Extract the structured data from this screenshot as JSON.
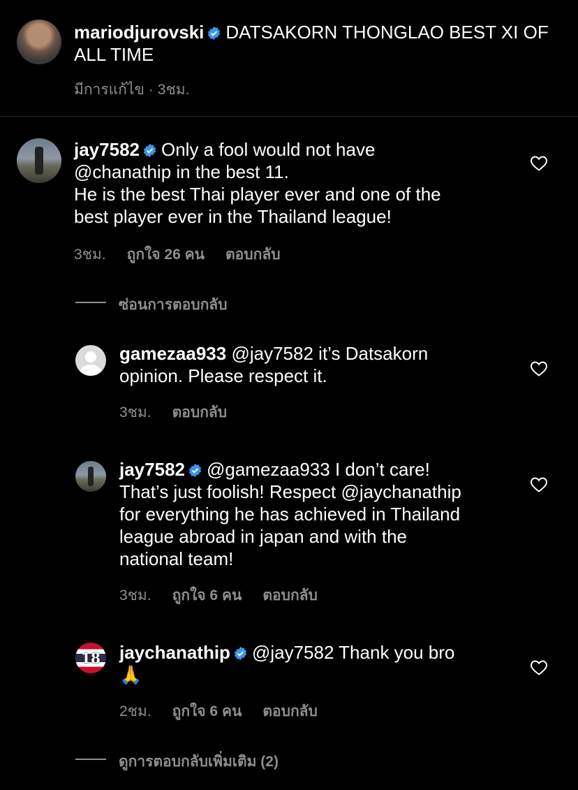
{
  "caption": {
    "username": "mariodjurovski",
    "text": "DATSAKORN THONGLAO BEST XI OF ALL TIME",
    "edited": "มีการแก้ไข",
    "time": "3ชม."
  },
  "comments": [
    {
      "username": "jay7582",
      "verified": true,
      "line1": "Only a fool would not have",
      "mention": "@chanathip",
      "line2": " in the best 11.",
      "line3": "He is the best Thai player ever and one of the",
      "line4": "best player ever in the Thailand league!",
      "time": "3ชม.",
      "likes": "ถูกใจ 26 คน",
      "reply": "ตอบกลับ"
    }
  ],
  "hide_replies": "ซ่อนการตอบกลับ",
  "replies": [
    {
      "username": "gamezaa933",
      "mention": "@jay7582",
      "line1": " it’s Datsakorn",
      "line2": "opinion. Please respect it.",
      "time": "3ชม.",
      "reply": "ตอบกลับ"
    },
    {
      "username": "jay7582",
      "mention": "@gamezaa933",
      "line1": " I don’t care!",
      "line2a": "That’s just foolish! Respect ",
      "mention2": "@jaychanathip",
      "line3": "for everything he has achieved in Thailand",
      "line4": "league abroad in japan and with the",
      "line5": "national team!",
      "time": "3ชม.",
      "likes": "ถูกใจ 6 คน",
      "reply": "ตอบกลับ"
    },
    {
      "username": "jaychanathip",
      "mention": "@jay7582",
      "line1": " Thank you bro",
      "emoji": "🙏",
      "avatar_text": "18",
      "time": "2ชม.",
      "likes": "ถูกใจ 6 คน",
      "reply": "ตอบกลับ"
    }
  ],
  "view_more": "ดูการตอบกลับเพิ่มเติม (2)",
  "colors": {
    "verified": "#3897f0",
    "muted": "#8e8e8e",
    "background": "#000000"
  }
}
